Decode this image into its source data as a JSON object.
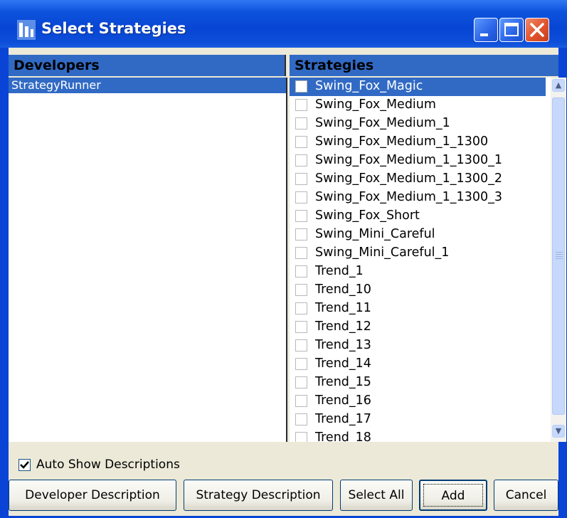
{
  "window": {
    "title": "Select Strategies"
  },
  "developers": {
    "header": "Developers",
    "items": [
      "StrategyRunner"
    ]
  },
  "strategies": {
    "header": "Strategies",
    "items": [
      "Swing_Fox_Magic",
      "Swing_Fox_Medium",
      "Swing_Fox_Medium_1",
      "Swing_Fox_Medium_1_1300",
      "Swing_Fox_Medium_1_1300_1",
      "Swing_Fox_Medium_1_1300_2",
      "Swing_Fox_Medium_1_1300_3",
      "Swing_Fox_Short",
      "Swing_Mini_Careful",
      "Swing_Mini_Careful_1",
      "Trend_1",
      "Trend_10",
      "Trend_11",
      "Trend_12",
      "Trend_13",
      "Trend_14",
      "Trend_15",
      "Trend_16",
      "Trend_17",
      "Trend_18"
    ]
  },
  "auto_show": {
    "label": "Auto Show Descriptions",
    "checked": true
  },
  "buttons": {
    "developer_description": "Developer Description",
    "strategy_description": "Strategy Description",
    "select_all": "Select All",
    "add": "Add",
    "cancel": "Cancel"
  },
  "colors": {
    "titlebar": "#0845d4",
    "selection": "#316ac5",
    "face": "#ece9d8"
  }
}
